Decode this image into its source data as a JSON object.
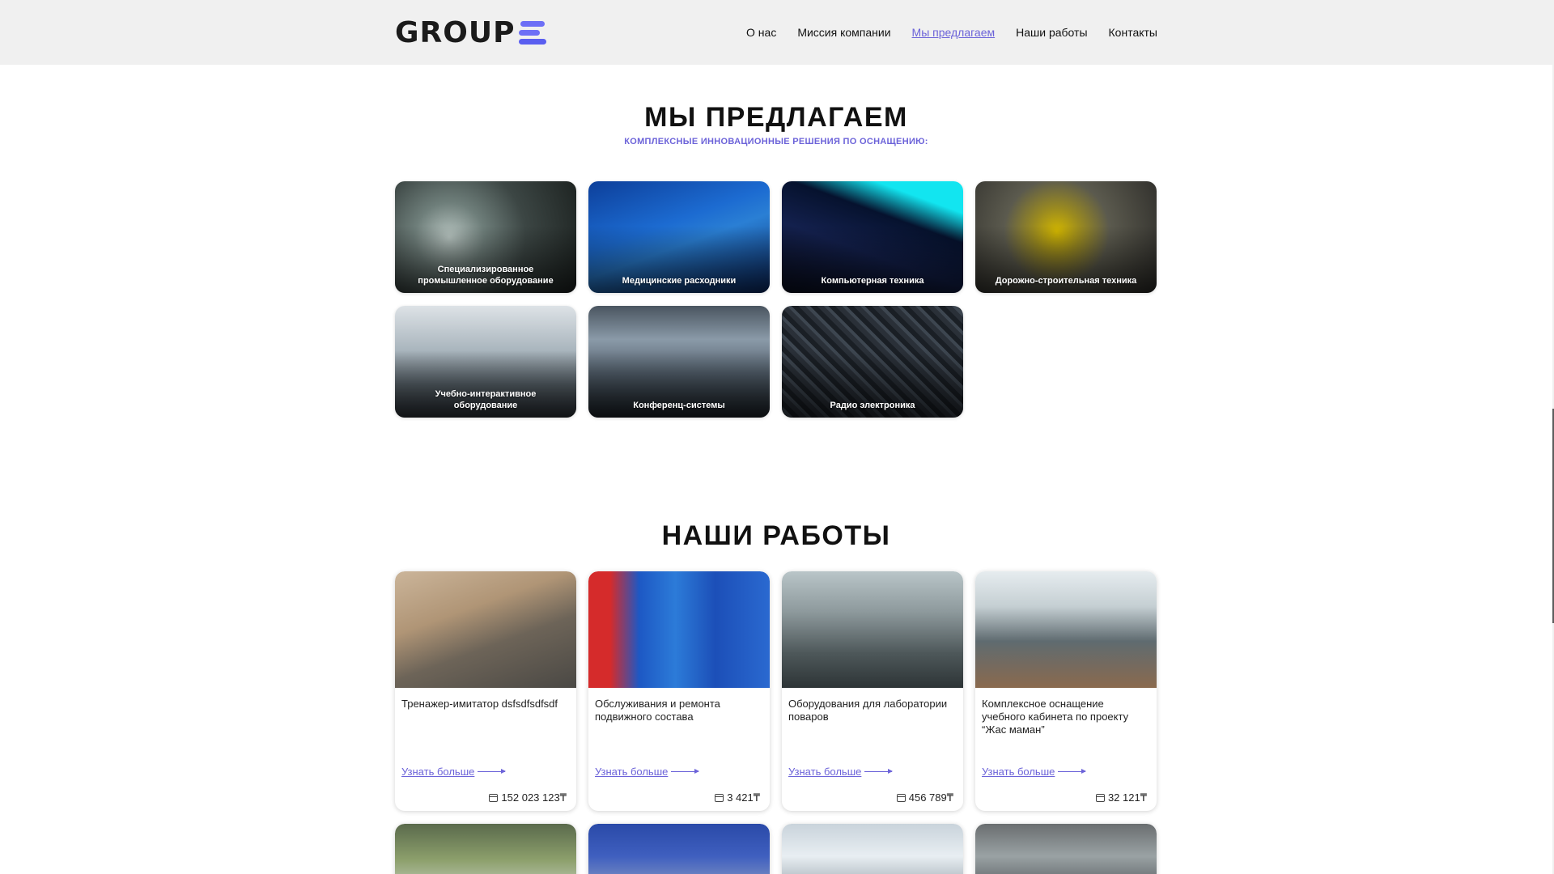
{
  "header": {
    "logo_text": "GROUP",
    "nav": [
      {
        "label": "О нас",
        "active": false
      },
      {
        "label": "Миссия компании",
        "active": false
      },
      {
        "label": "Мы предлагаем",
        "active": true
      },
      {
        "label": "Наши работы",
        "active": false
      },
      {
        "label": "Контакты",
        "active": false
      }
    ]
  },
  "offers": {
    "title": "МЫ ПРЕДЛАГАЕМ",
    "subtitle": "КОМПЛЕКСНЫЕ ИННОВАЦИОННЫЕ РЕШЕНИЯ ПО ОСНАЩЕНИЮ:",
    "items": [
      {
        "label": "Специализированное промышленное оборудование"
      },
      {
        "label": "Медицинские расходники"
      },
      {
        "label": "Компьютерная техника"
      },
      {
        "label": "Дорожно-строительная техника"
      },
      {
        "label": "Учебно-интерактивное оборудование"
      },
      {
        "label": "Конференц-системы"
      },
      {
        "label": "Радио электроника"
      }
    ]
  },
  "works": {
    "title": "НАШИ РАБОТЫ",
    "more_label": "Узнать больше",
    "items": [
      {
        "title": "Тренажер-имитатор dsfsdfsdfsdf",
        "price": "152 023 123₸"
      },
      {
        "title": "Обслуживания и ремонта подвижного состава",
        "price": "3 421₸"
      },
      {
        "title": "Оборудования для лаборатории поваров",
        "price": "456 789₸"
      },
      {
        "title": "Комплексное оснащение учебного кабинета по проекту “Жас маман”",
        "price": "32 121₸"
      }
    ]
  },
  "colors": {
    "accent": "#6c63d9",
    "header_bg": "#f0f0f0",
    "top_marker": "#e0424e"
  }
}
